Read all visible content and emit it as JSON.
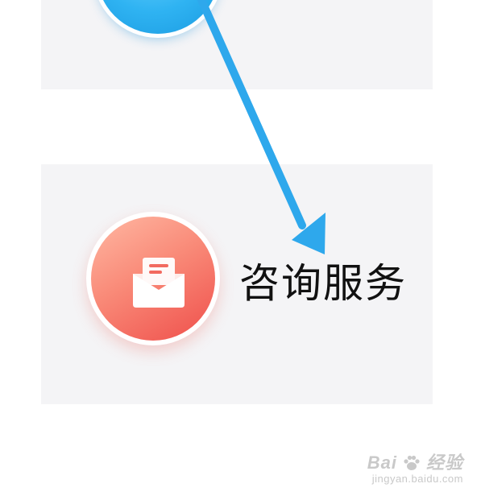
{
  "service": {
    "label": "咨询服务",
    "icon": "mail-envelope-icon"
  },
  "top_button": {
    "icon": "blue-circle-icon"
  },
  "annotation": {
    "type": "arrow",
    "color": "#2ea8ec"
  },
  "watermark": {
    "brand_a": "Bai",
    "brand_b": "经验",
    "url": "jingyan.baidu.com"
  },
  "colors": {
    "card_bg": "#f4f4f6",
    "red_gradient_start": "#ffb8a3",
    "red_gradient_end": "#ef4f4b",
    "blue_circle": "#2fb3f2"
  }
}
